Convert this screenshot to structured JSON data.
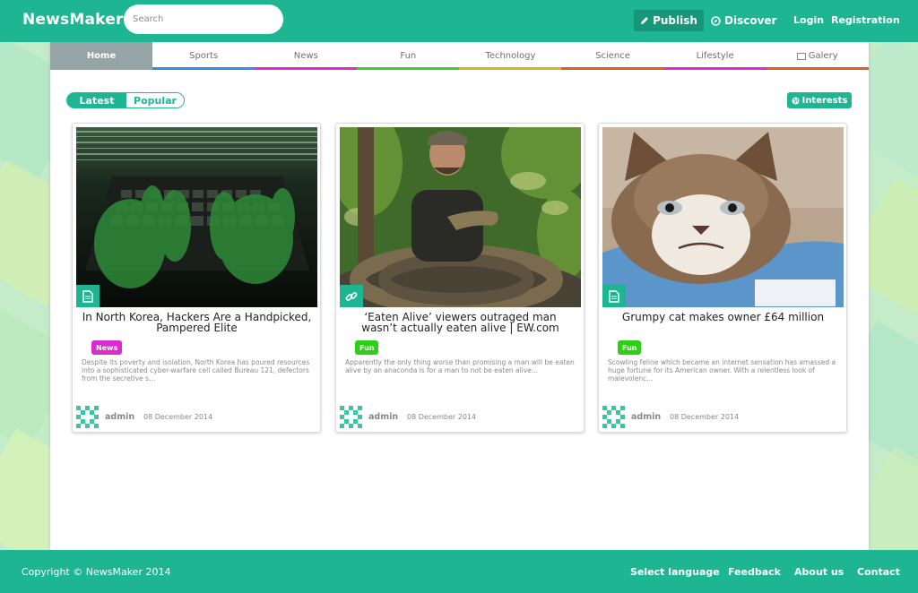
{
  "header": {
    "logo": "NewsMaker",
    "search_placeholder": "Search",
    "publish_label": "Publish",
    "discover_label": "Discover",
    "login_label": "Login",
    "registration_label": "Registration"
  },
  "tabs": [
    {
      "label": "Home",
      "color": "#95a5a6"
    },
    {
      "label": "Sports",
      "color": "#2f8fd8"
    },
    {
      "label": "News",
      "color": "#d92bd1"
    },
    {
      "label": "Fun",
      "color": "#3ccf29"
    },
    {
      "label": "Technology",
      "color": "#cbb81a"
    },
    {
      "label": "Science",
      "color": "#e35c1f"
    },
    {
      "label": "Lifestyle",
      "color": "#d92bd1"
    },
    {
      "label": "Galery",
      "color": "#e35c1f"
    }
  ],
  "filters": {
    "latest_label": "Latest",
    "popular_label": "Popular",
    "interests_label": "Interests"
  },
  "cards": [
    {
      "title": "In North Korea, Hackers Are a Handpicked, Pampered Elite",
      "category": "News",
      "category_color": "#d92bd1",
      "excerpt": "Despite its poverty and isolation, North Korea has poured resources into a sophisticated cyber-warfare cell called Bureau 121, defectors from the secretive s...",
      "author": "admin",
      "date": "08 December 2014",
      "type_icon": "document-icon"
    },
    {
      "title": "‘Eaten Alive’ viewers outraged man wasn’t actually eaten alive | EW.com",
      "category": "Fun",
      "category_color": "#2ed017",
      "excerpt": "Apparently the only thing worse than promising a man will be eaten alive by an anaconda is for a man to not be eaten alive...",
      "author": "admin",
      "date": "08 December 2014",
      "type_icon": "link-icon"
    },
    {
      "title": "Grumpy cat makes owner £64 million",
      "category": "Fun",
      "category_color": "#2ed017",
      "excerpt": "Scowling feline which became an internet sensation has amassed a huge fortune for its American owner. With a relentless look of malevolenc...",
      "author": "admin",
      "date": "08 December 2014",
      "type_icon": "document-icon"
    }
  ],
  "footer": {
    "copyright": "Copyright © NewsMaker 2014",
    "select_language": "Select language",
    "feedback": "Feedback",
    "about_us": "About us",
    "contact": "Contact"
  },
  "colors": {
    "brand": "#1db592",
    "brand_dark": "#17967a"
  }
}
